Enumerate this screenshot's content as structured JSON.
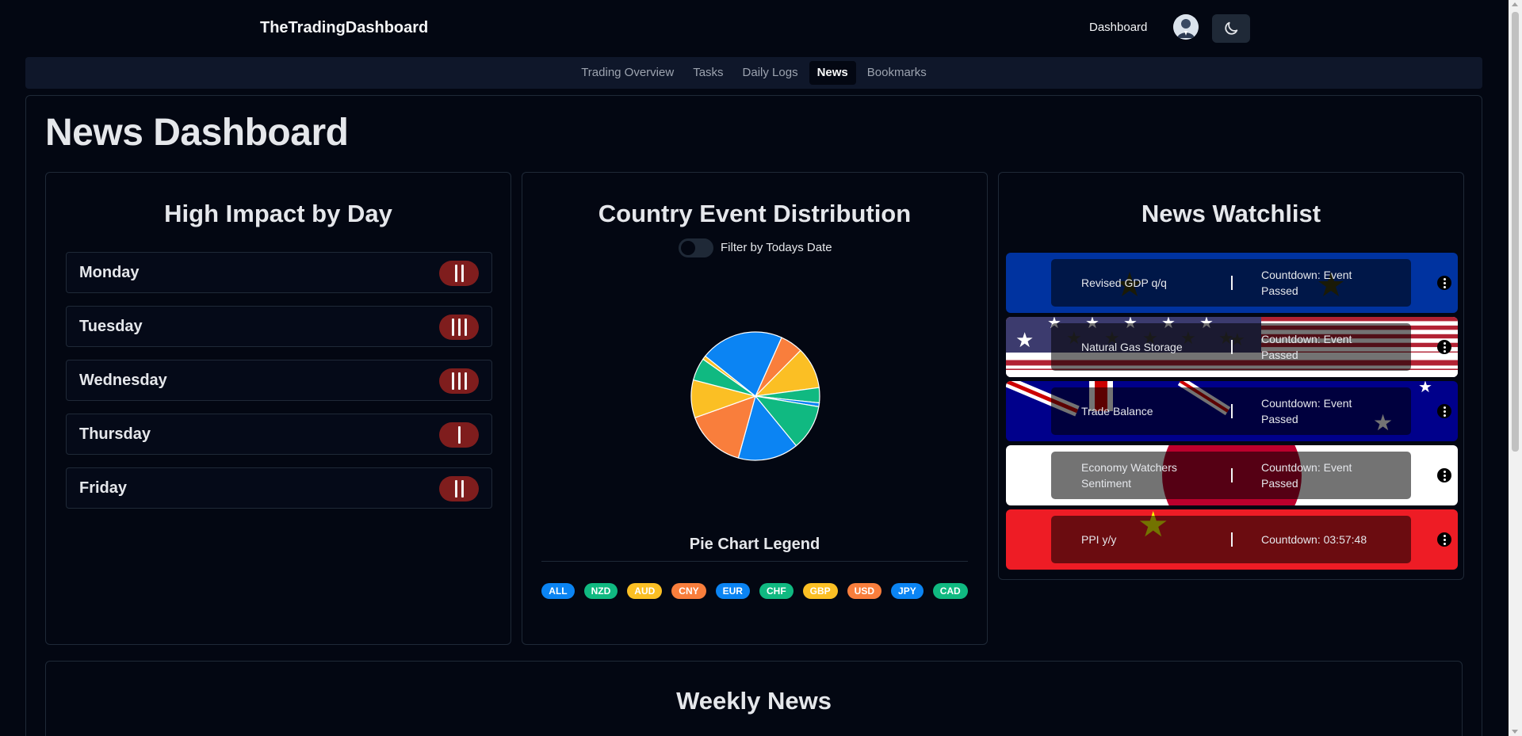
{
  "header": {
    "brand": "TheTradingDashboard",
    "dashboard_link": "Dashboard",
    "avatar_icon": "user-avatar",
    "theme_icon": "moon-icon"
  },
  "nav": {
    "tabs": [
      {
        "label": "Trading Overview",
        "active": false
      },
      {
        "label": "Tasks",
        "active": false
      },
      {
        "label": "Daily Logs",
        "active": false
      },
      {
        "label": "News",
        "active": true
      },
      {
        "label": "Bookmarks",
        "active": false
      }
    ]
  },
  "page": {
    "title": "News Dashboard"
  },
  "high_impact": {
    "title": "High Impact by Day",
    "days": [
      {
        "name": "Monday",
        "count": 2
      },
      {
        "name": "Tuesday",
        "count": 3
      },
      {
        "name": "Wednesday",
        "count": 3
      },
      {
        "name": "Thursday",
        "count": 1
      },
      {
        "name": "Friday",
        "count": 2
      }
    ]
  },
  "distribution": {
    "title": "Country Event Distribution",
    "toggle_label": "Filter by Todays Date",
    "toggle_on": false,
    "legend_title": "Pie Chart Legend",
    "badges": [
      {
        "label": "ALL",
        "color": "#0b84f3"
      },
      {
        "label": "NZD",
        "color": "#10b981"
      },
      {
        "label": "AUD",
        "color": "#fbbf24"
      },
      {
        "label": "CNY",
        "color": "#f97e3c"
      },
      {
        "label": "EUR",
        "color": "#0b84f3"
      },
      {
        "label": "CHF",
        "color": "#10b981"
      },
      {
        "label": "GBP",
        "color": "#fbbf24"
      },
      {
        "label": "USD",
        "color": "#f97e3c"
      },
      {
        "label": "JPY",
        "color": "#0b84f3"
      },
      {
        "label": "CAD",
        "color": "#10b981"
      }
    ]
  },
  "chart_data": {
    "type": "pie",
    "slices": [
      {
        "value": 6,
        "color": "#f97e3c"
      },
      {
        "value": 11,
        "color": "#fbbf24"
      },
      {
        "value": 4,
        "color": "#10b981"
      },
      {
        "value": 1,
        "color": "#0b84f3"
      },
      {
        "value": 12,
        "color": "#10b981"
      },
      {
        "value": 16,
        "color": "#0b84f3"
      },
      {
        "value": 16,
        "color": "#f97e3c"
      },
      {
        "value": 10,
        "color": "#fbbf24"
      },
      {
        "value": 6,
        "color": "#10b981"
      },
      {
        "value": 1,
        "color": "#fbbf24"
      },
      {
        "value": 22,
        "color": "#0b84f3"
      }
    ]
  },
  "watchlist": {
    "title": "News Watchlist",
    "items": [
      {
        "event": "Revised GDP q/q",
        "countdown": "Countdown: Event Passed",
        "flag": "eu"
      },
      {
        "event": "Natural Gas Storage",
        "countdown": "Countdown: Event Passed",
        "flag": "us"
      },
      {
        "event": "Trade Balance",
        "countdown": "Countdown: Event Passed",
        "flag": "au"
      },
      {
        "event": "Economy Watchers Sentiment",
        "countdown": "Countdown: Event Passed",
        "flag": "jp"
      },
      {
        "event": "PPI y/y",
        "countdown": "Countdown: 03:57:48",
        "flag": "cn"
      }
    ]
  },
  "weekly": {
    "title": "Weekly News"
  }
}
